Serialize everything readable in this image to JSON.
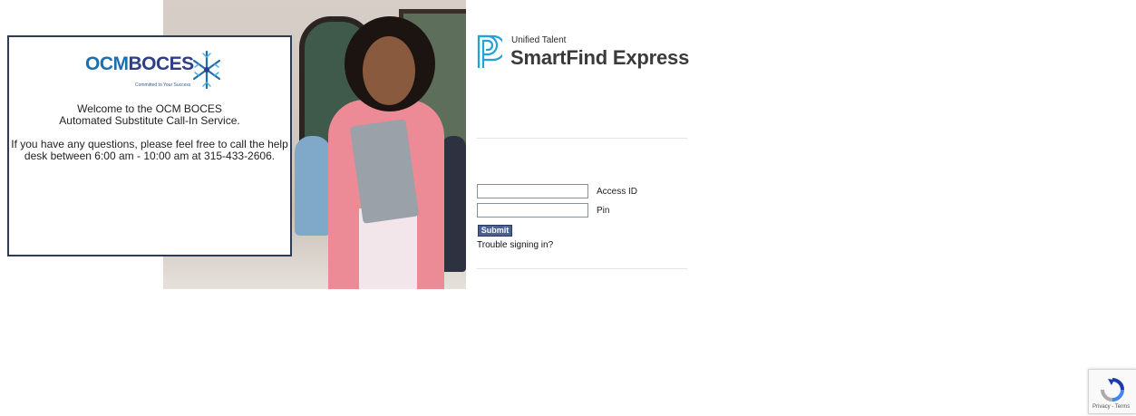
{
  "welcome": {
    "logo": {
      "ocm": "OCM",
      "boces": "BOCES",
      "tagline": "Committed to Your Success"
    },
    "line1": "Welcome to the OCM BOCES",
    "line2": "Automated Substitute Call-In Service.",
    "line3": "If you have any questions, please feel free to call the help",
    "line4": "desk between 6:00 am - 10:00 am at 315-433-2606."
  },
  "brand": {
    "subtitle": "Unified Talent",
    "name": "SmartFind Express",
    "color": "#1fa3d8"
  },
  "login": {
    "access_id_label": "Access ID",
    "access_id_value": "",
    "pin_label": "Pin",
    "pin_value": "",
    "submit_label": "Submit",
    "trouble_link": "Trouble signing in?"
  },
  "recaptcha": {
    "links": "Privacy - Terms"
  }
}
